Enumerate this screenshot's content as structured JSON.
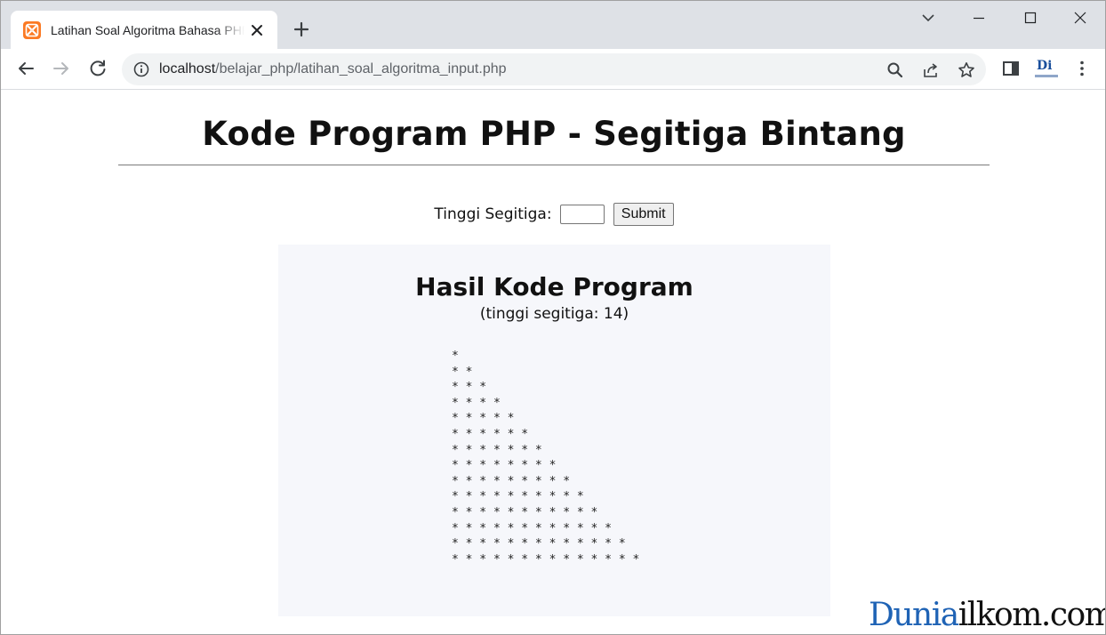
{
  "browser": {
    "tab": {
      "title": "Latihan Soal Algoritma Bahasa PHP",
      "close_label": "×"
    },
    "url": {
      "host": "localhost",
      "path": "/belajar_php/latihan_soal_algoritma_input.php"
    },
    "extension_label": "Di"
  },
  "page": {
    "title": "Kode Program PHP - Segitiga Bintang",
    "form": {
      "label": "Tinggi Segitiga:",
      "input_value": "",
      "submit_label": "Submit"
    },
    "result": {
      "title": "Hasil Kode Program",
      "subtitle": "(tinggi segitiga: 14)",
      "rows": [
        "*",
        "* *",
        "* * *",
        "* * * *",
        "* * * * *",
        "* * * * * *",
        "* * * * * * *",
        "* * * * * * * *",
        "* * * * * * * * *",
        "* * * * * * * * * *",
        "* * * * * * * * * * *",
        "* * * * * * * * * * * *",
        "* * * * * * * * * * * * *",
        "* * * * * * * * * * * * * *"
      ]
    },
    "watermark": {
      "part1": "Dunia",
      "part2": "ilkom.com"
    }
  },
  "colors": {
    "tabstrip": "#dee1e6",
    "favicon": "#fb7a24",
    "result_bg": "#f6f7fb",
    "watermark_blue": "#1f63b5"
  }
}
